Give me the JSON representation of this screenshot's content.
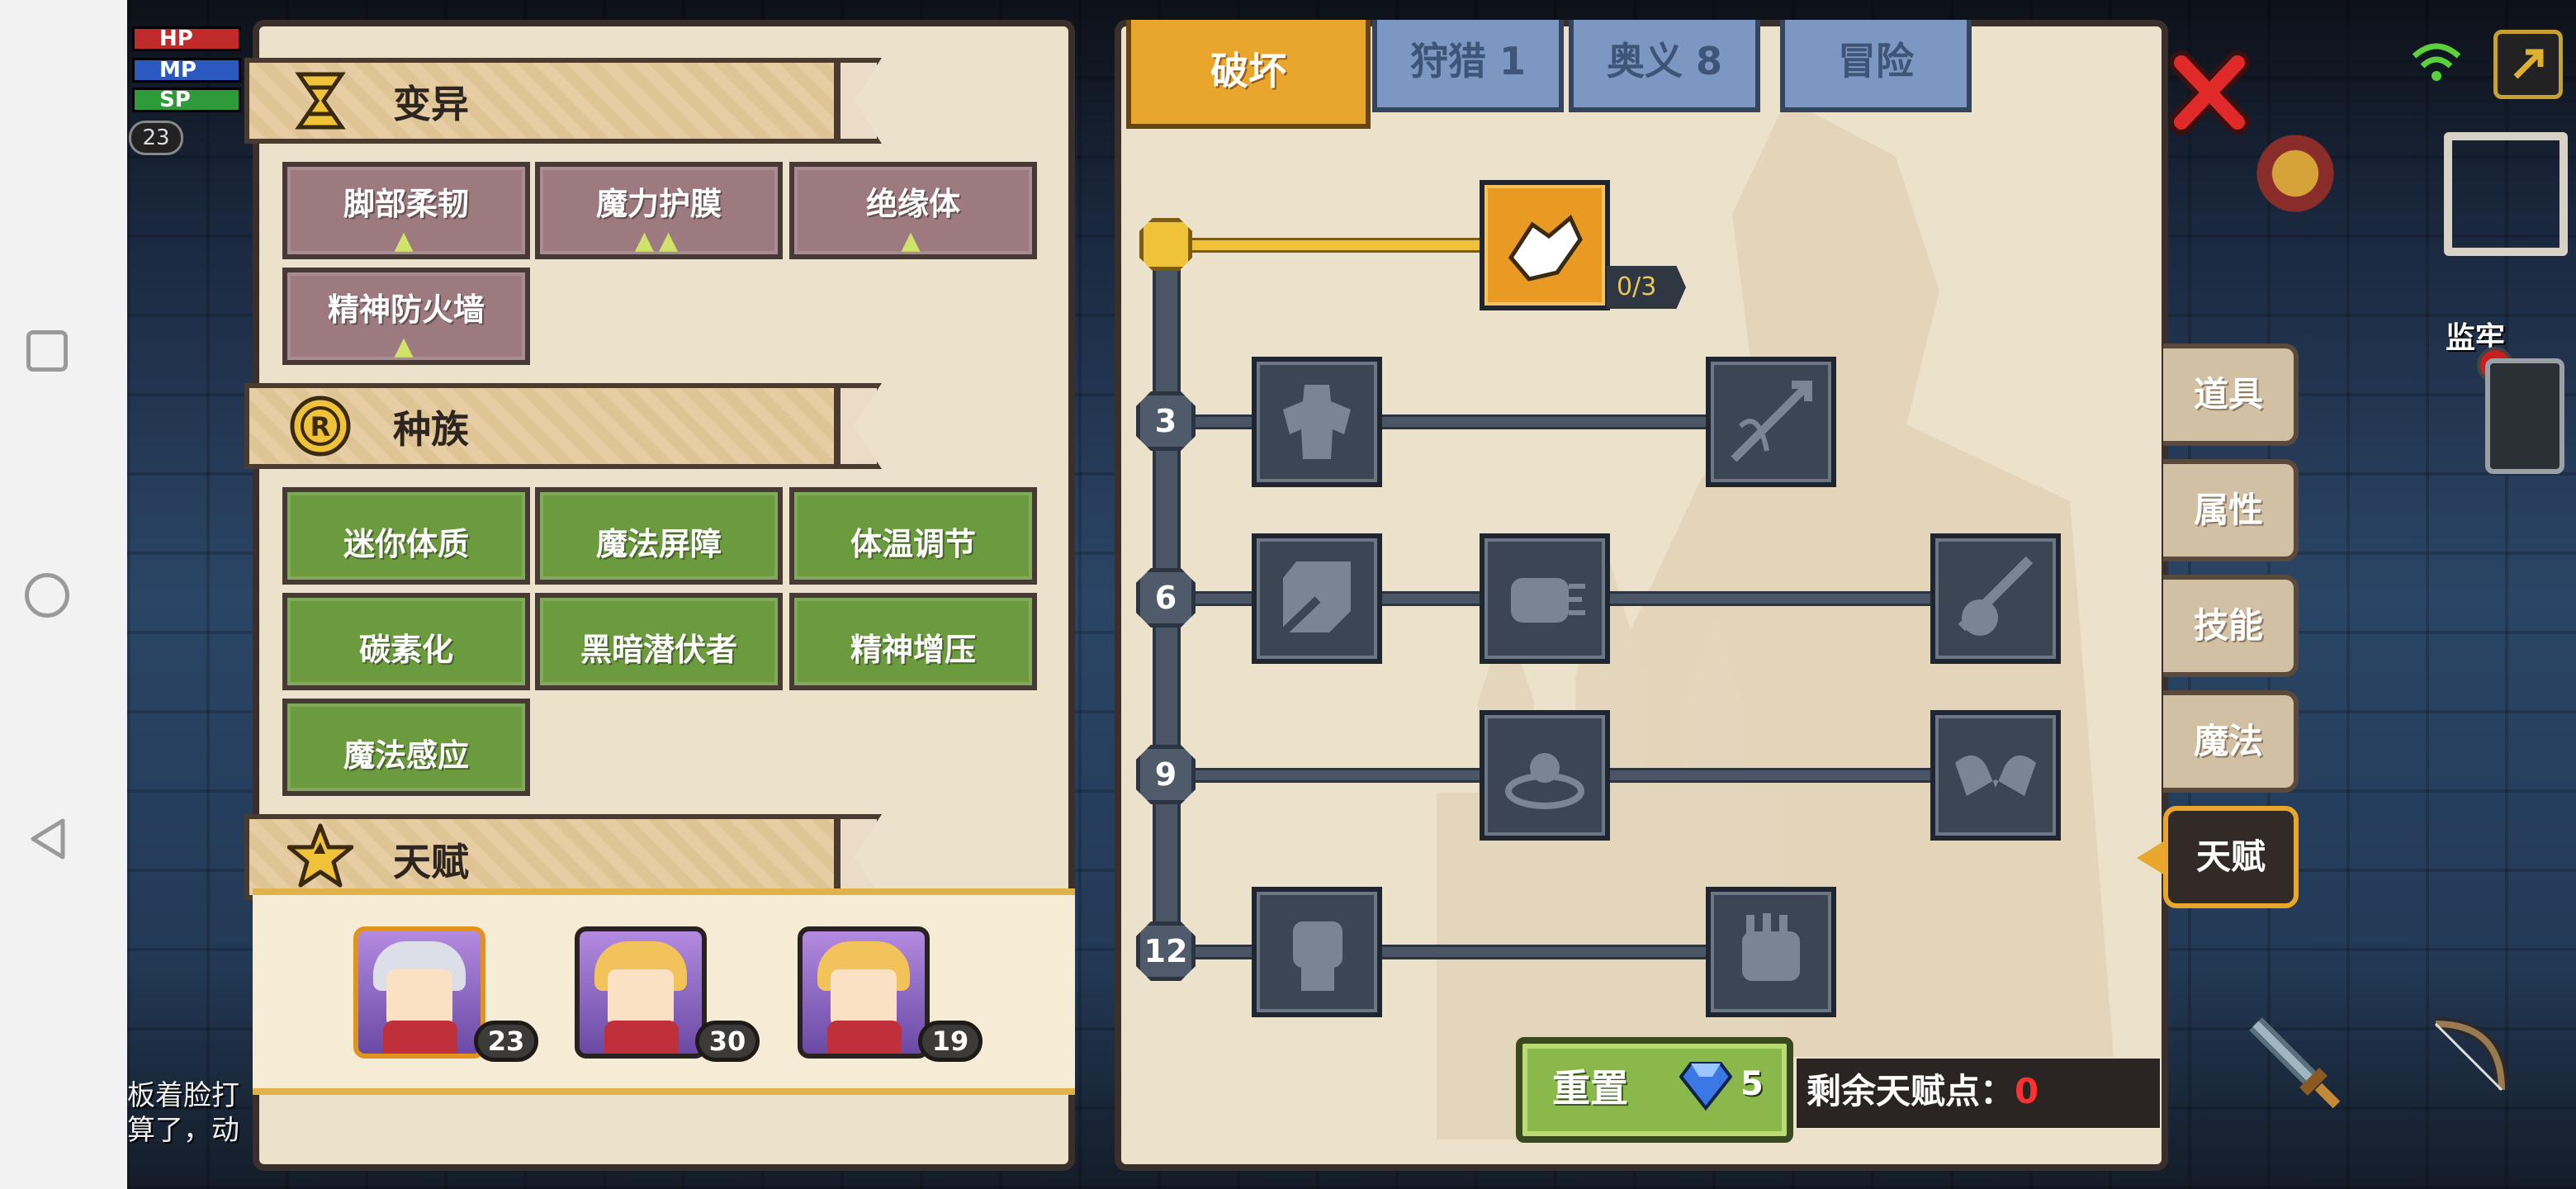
{
  "hud": {
    "hp": "HP",
    "mp": "MP",
    "sp": "SP",
    "level": "23"
  },
  "chat": {
    "line1": "板着脸打",
    "line2": "算了，动"
  },
  "mutation": {
    "title": "变异",
    "items": [
      {
        "label": "脚部柔韧",
        "marks": "▲"
      },
      {
        "label": "魔力护膜",
        "marks": "▲▲"
      },
      {
        "label": "绝缘体",
        "marks": "▲"
      },
      {
        "label": "精神防火墙",
        "marks": "▲"
      }
    ]
  },
  "race": {
    "title": "种族",
    "items": [
      {
        "label": "迷你体质"
      },
      {
        "label": "魔法屏障"
      },
      {
        "label": "体温调节"
      },
      {
        "label": "碳素化"
      },
      {
        "label": "黑暗潜伏者"
      },
      {
        "label": "精神增压"
      },
      {
        "label": "魔法感应"
      }
    ]
  },
  "talent_section": {
    "title": "天赋"
  },
  "characters": [
    {
      "level": "23",
      "selected": true
    },
    {
      "level": "30",
      "selected": false
    },
    {
      "level": "19",
      "selected": false
    }
  ],
  "tabs": [
    {
      "label": "破坏",
      "active": true
    },
    {
      "label": "狩猎 1",
      "active": false
    },
    {
      "label": "奥义 8",
      "active": false
    },
    {
      "label": "冒险",
      "active": false
    }
  ],
  "talent_tree": {
    "first_skill_progress": "0/3",
    "tiers": [
      "3",
      "6",
      "9",
      "12"
    ]
  },
  "side_tabs": [
    {
      "label": "道具",
      "active": false
    },
    {
      "label": "属性",
      "active": false
    },
    {
      "label": "技能",
      "active": false
    },
    {
      "label": "魔法",
      "active": false
    },
    {
      "label": "天赋",
      "active": true
    }
  ],
  "footer": {
    "reset_label": "重置",
    "reset_cost": "5",
    "remaining_label": "剩余天赋点：",
    "remaining_value": "0"
  },
  "map": {
    "location_label": "监牢"
  },
  "colors": {
    "active_tab": "#e9a62c",
    "race_trait": "#6c9a3e",
    "mutation_trait": "#9c7a80",
    "remaining_value": "#ff3030"
  }
}
